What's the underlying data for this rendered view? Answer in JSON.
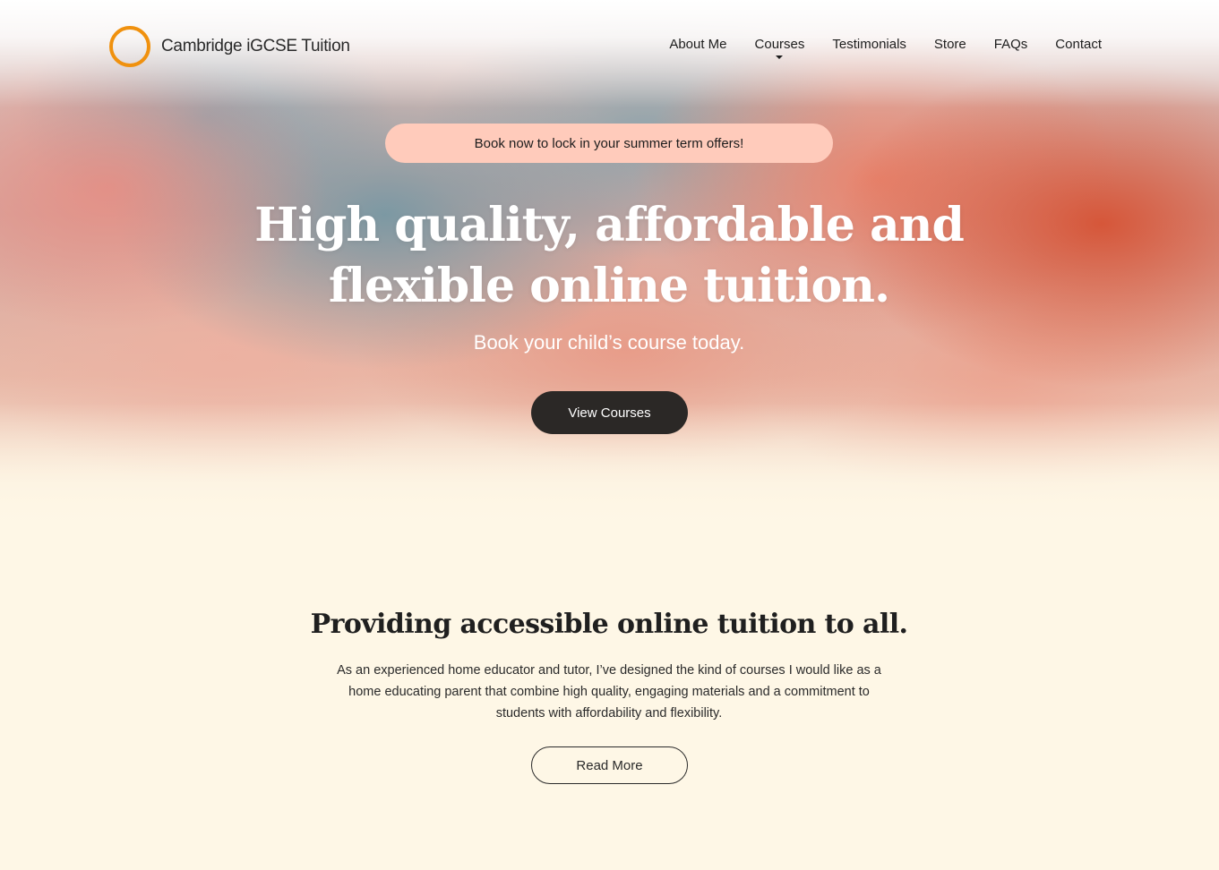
{
  "header": {
    "logo_text": "Cambridge iGCSE Tuition",
    "nav": [
      {
        "label": "About Me"
      },
      {
        "label": "Courses"
      },
      {
        "label": "Testimonials"
      },
      {
        "label": "Store"
      },
      {
        "label": "FAQs"
      },
      {
        "label": "Contact"
      }
    ]
  },
  "hero": {
    "promo": "Book now to lock in your summer term offers!",
    "title": "High quality, affordable and flexible online tuition.",
    "subtitle": "Book your child’s course today.",
    "cta_label": "View Courses"
  },
  "about": {
    "title": "Providing accessible online tuition to all.",
    "body": "As an experienced home educator and tutor, I’ve designed the kind of courses I would like as a home educating parent that combine high quality, engaging materials and a commitment to students with affordability and flexibility.",
    "cta_label": "Read More"
  },
  "colors": {
    "logo_ring": "#f0910e",
    "promo_bg": "#ffcbbb",
    "dark_button": "#2b2826",
    "section_bg": "#fef7e6"
  },
  "icons": {
    "logo": "ring-logo-icon",
    "dropdown": "caret-down-icon"
  }
}
